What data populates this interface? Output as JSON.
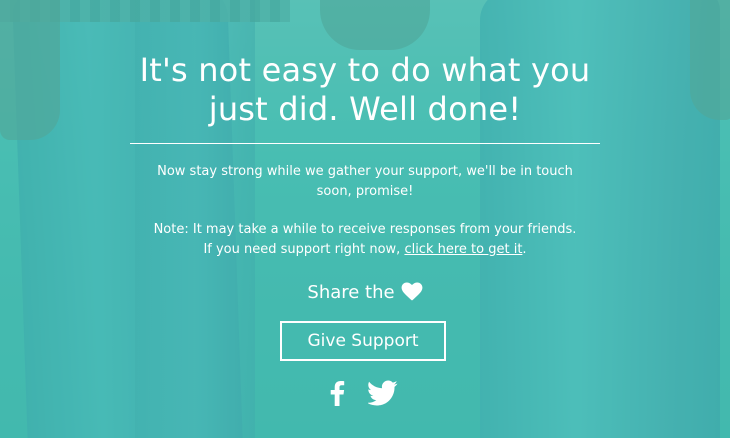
{
  "headline": "It's not easy to do what you just did. Well done!",
  "message": "Now stay strong while we gather your support, we'll be in touch soon, promise!",
  "note_text": "Note: It may take a while to receive responses from your friends. If you need support right now, ",
  "note_link": "click here to get it",
  "note_end": ".",
  "share_label": "Share the",
  "give_support_button": "Give Support",
  "colors": {
    "accent": "#46beb2",
    "text": "#ffffff"
  },
  "icons": {
    "share": "heart-icon",
    "social": [
      "facebook-icon",
      "twitter-icon"
    ]
  }
}
